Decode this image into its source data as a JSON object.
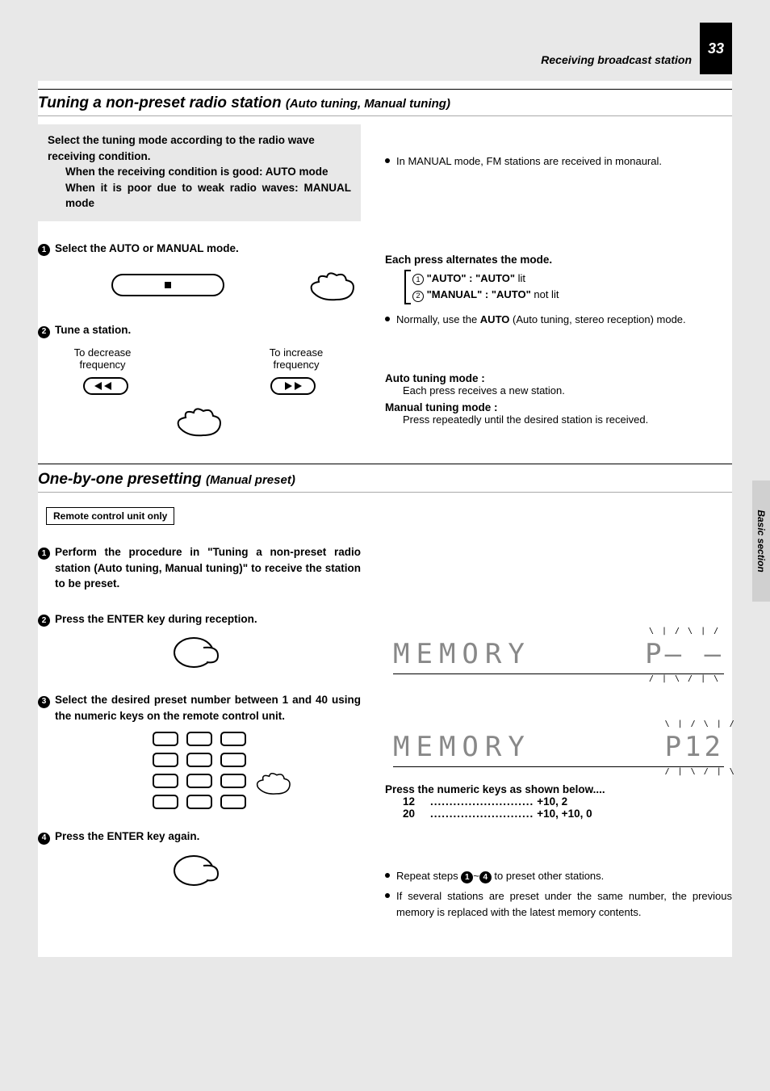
{
  "page_number": "33",
  "header": "Receiving broadcast station",
  "side_tab": "Basic section",
  "section1": {
    "title": "Tuning a non-preset radio station",
    "subtitle": "(Auto tuning, Manual tuning)",
    "intro_line1": "Select the tuning mode according to the radio wave receiving condition.",
    "intro_line2": "When the receiving condition is good: AUTO mode",
    "intro_line3": "When it is poor due to weak radio waves: MANUAL mode",
    "step1": "Select the AUTO or MANUAL mode.",
    "step2": "Tune a station.",
    "freq_dec": "To decrease frequency",
    "freq_inc": "To increase frequency",
    "right_bullet1": "In MANUAL mode, FM stations are received in monaural.",
    "alt_heading": "Each press alternates the mode.",
    "mode1_label": "\"AUTO\" : \"AUTO\"",
    "mode1_state": "lit",
    "mode2_label": "\"MANUAL\" : \"AUTO\"",
    "mode2_state": "not lit",
    "right_bullet2_pre": "Normally, use the ",
    "right_bullet2_bold": "AUTO",
    "right_bullet2_post": " (Auto tuning, stereo reception) mode.",
    "auto_title": "Auto tuning mode :",
    "auto_desc": "Each press receives a new station.",
    "manual_title": "Manual tuning mode :",
    "manual_desc": "Press repeatedly until the desired station is received."
  },
  "section2": {
    "title": "One-by-one presetting",
    "subtitle": "(Manual preset)",
    "remote_only": "Remote control unit only",
    "step1": "Perform the procedure in \"Tuning a non-preset radio station  (Auto tuning, Manual tuning)\" to receive the station to be preset.",
    "step2": "Press the ENTER key during reception.",
    "step3": "Select the desired preset number between 1 and 40 using the numeric keys on the remote control unit.",
    "step4": "Press the ENTER key again.",
    "lcd1_text": "MEMORY",
    "lcd1_preset": "P– –",
    "lcd2_text": "MEMORY",
    "lcd2_preset": "P12",
    "numkeys_heading": "Press the numeric keys as shown below....",
    "numkey1_k": "12",
    "numkey1_v": "+10, 2",
    "numkey2_k": "20",
    "numkey2_v": "+10, +10, 0",
    "repeat_pre": "Repeat steps ",
    "repeat_mid": "~",
    "repeat_post": " to preset other stations.",
    "bullet2": "If several stations are preset under the same number, the previous memory is replaced with the latest memory contents."
  }
}
